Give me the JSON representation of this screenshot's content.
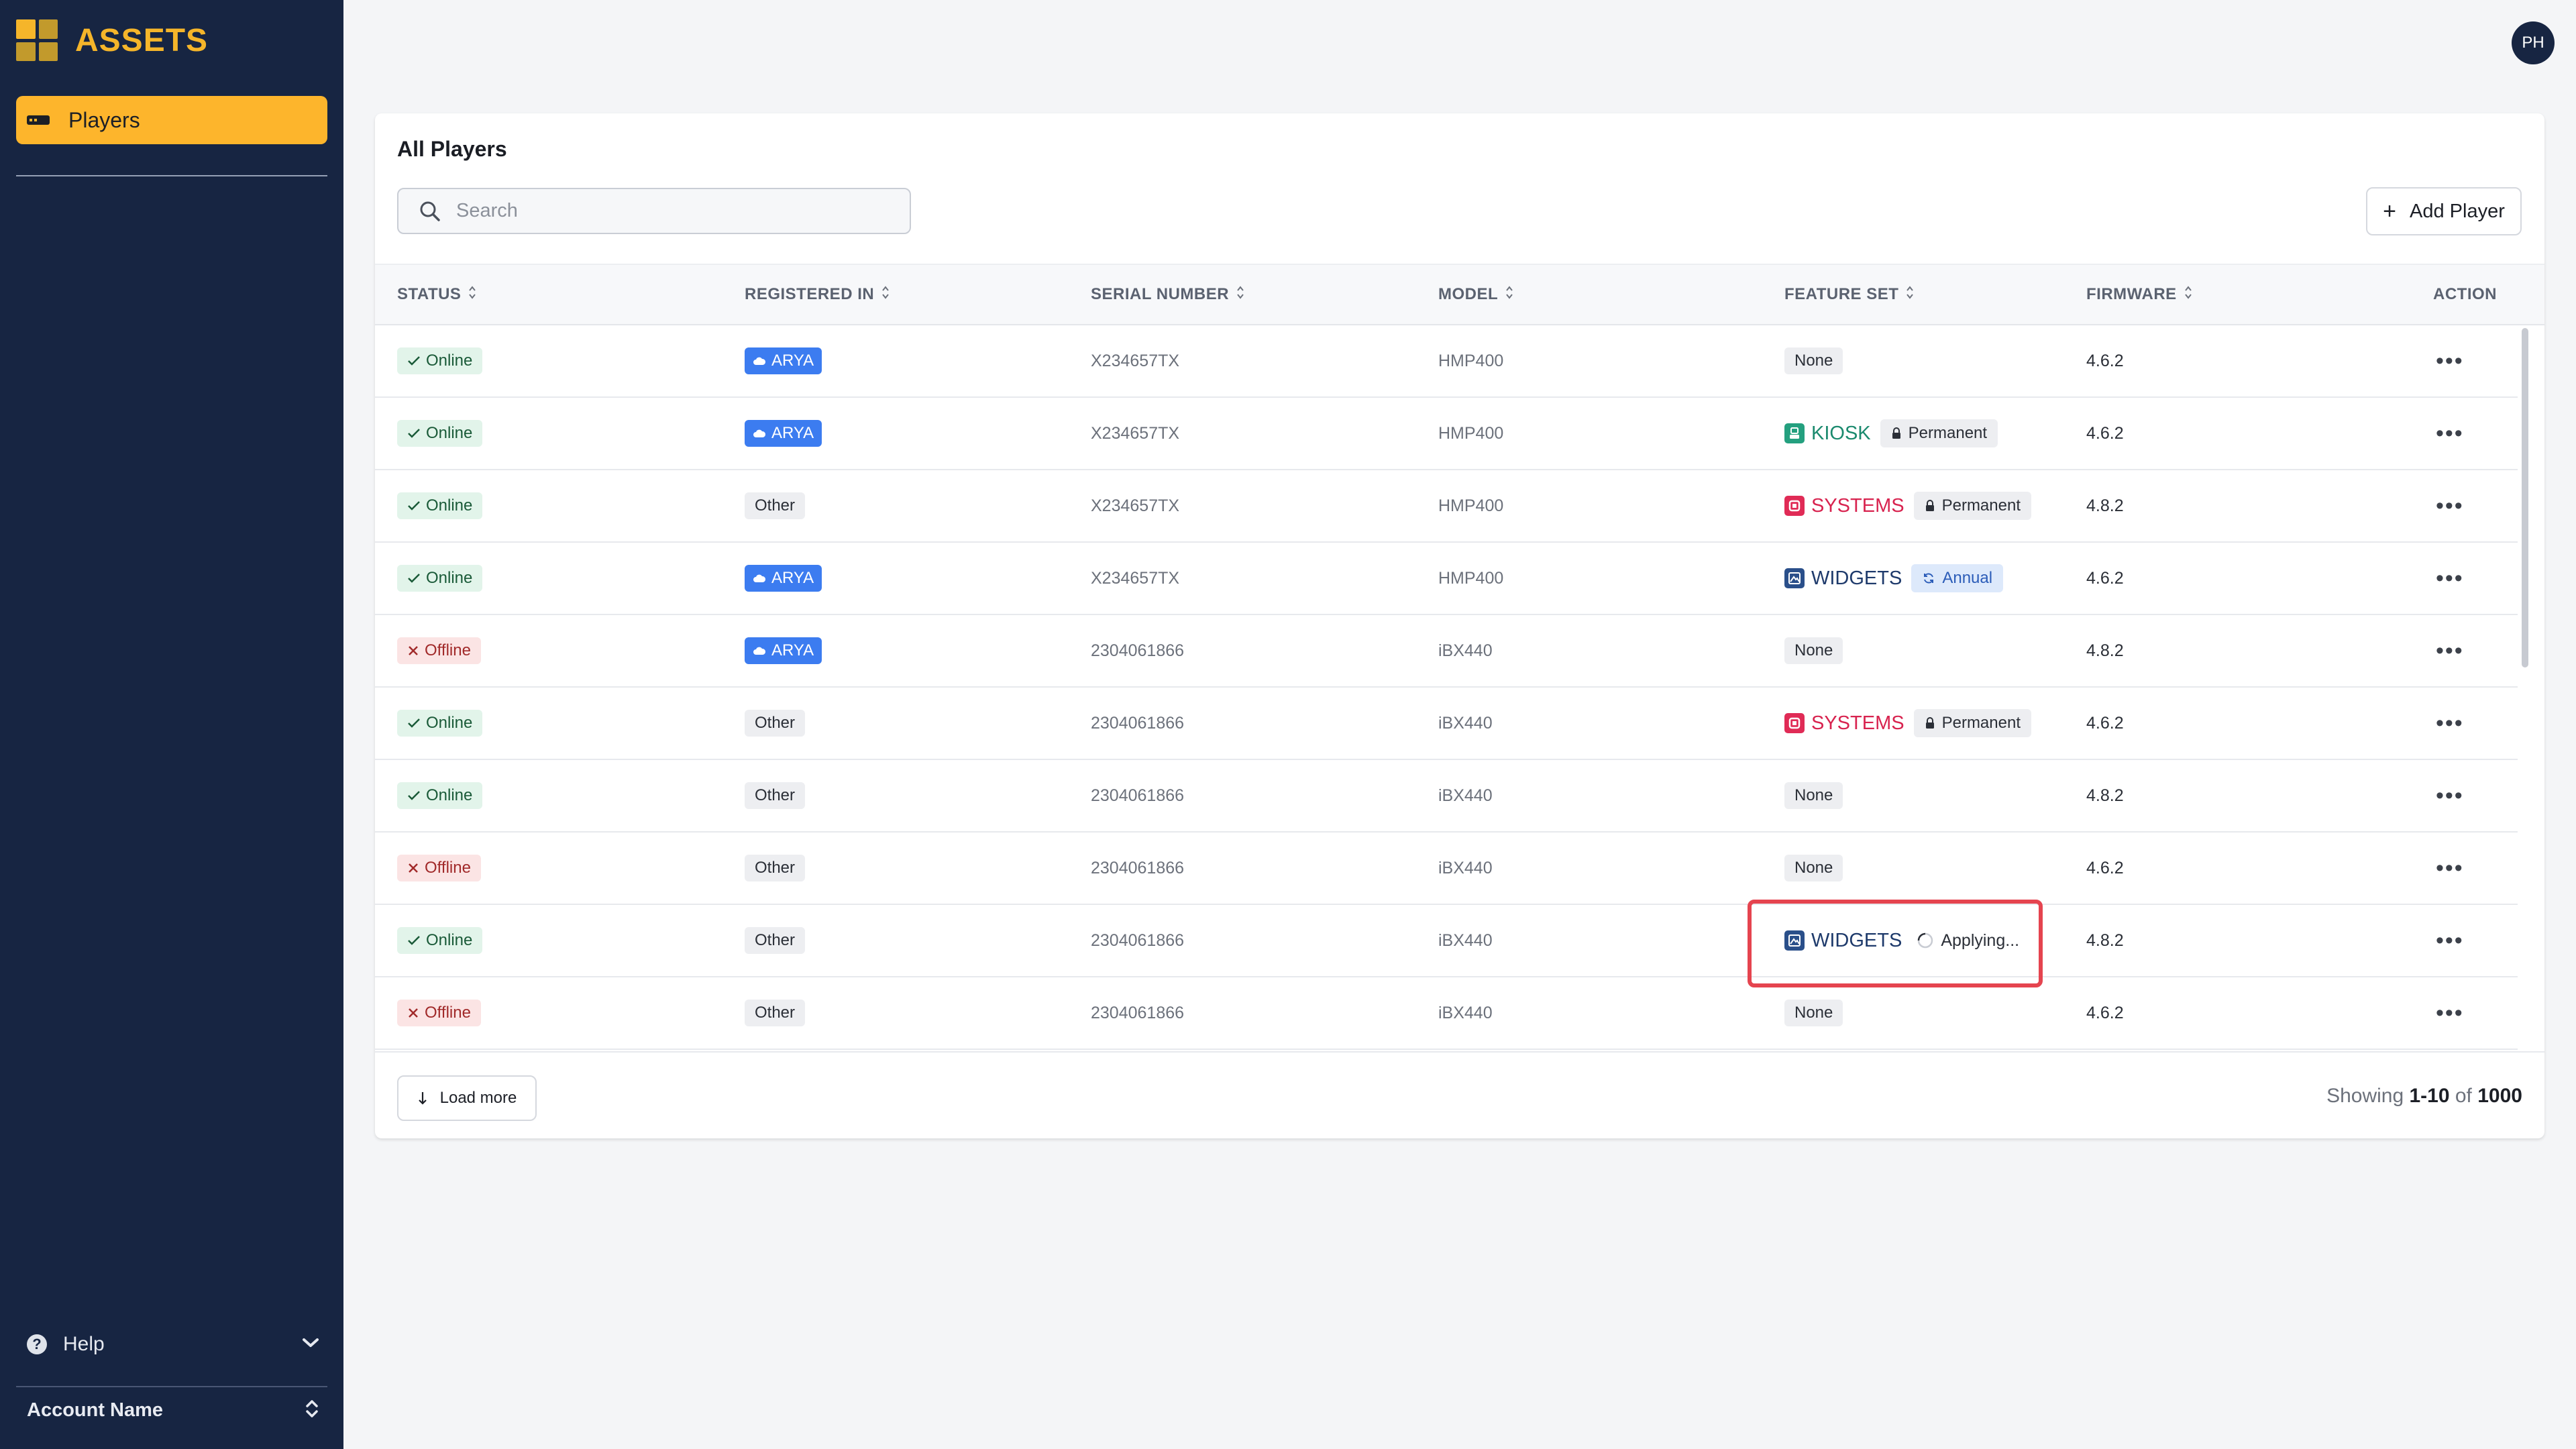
{
  "app": {
    "brand": "ASSETS"
  },
  "sidebar": {
    "nav": [
      {
        "label": "Players",
        "icon": "player-icon",
        "active": true
      }
    ],
    "help_label": "Help",
    "account_label": "Account Name"
  },
  "user": {
    "initials": "PH"
  },
  "main": {
    "title": "All Players",
    "search_placeholder": "Search",
    "add_button_label": "Add Player",
    "columns": [
      "STATUS",
      "REGISTERED IN",
      "SERIAL NUMBER",
      "MODEL",
      "FEATURE SET",
      "FIRMWARE",
      "ACTION"
    ],
    "rows": [
      {
        "status": "Online",
        "registered": "ARYA",
        "serial": "X234657TX",
        "model": "HMP400",
        "feature": "None",
        "license": "",
        "firmware": "4.6.2",
        "action": "•••"
      },
      {
        "status": "Online",
        "registered": "ARYA",
        "serial": "X234657TX",
        "model": "HMP400",
        "feature": "KIOSK",
        "license": "Permanent",
        "firmware": "4.6.2",
        "action": "•••"
      },
      {
        "status": "Online",
        "registered": "Other",
        "serial": "X234657TX",
        "model": "HMP400",
        "feature": "SYSTEMS",
        "license": "Permanent",
        "firmware": "4.8.2",
        "action": "•••"
      },
      {
        "status": "Online",
        "registered": "ARYA",
        "serial": "X234657TX",
        "model": "HMP400",
        "feature": "WIDGETS",
        "license": "Annual",
        "firmware": "4.6.2",
        "action": "•••"
      },
      {
        "status": "Offline",
        "registered": "ARYA",
        "serial": "2304061866",
        "model": "iBX440",
        "feature": "None",
        "license": "",
        "firmware": "4.8.2",
        "action": "•••"
      },
      {
        "status": "Online",
        "registered": "Other",
        "serial": "2304061866",
        "model": "iBX440",
        "feature": "SYSTEMS",
        "license": "Permanent",
        "firmware": "4.6.2",
        "action": "•••"
      },
      {
        "status": "Online",
        "registered": "Other",
        "serial": "2304061866",
        "model": "iBX440",
        "feature": "None",
        "license": "",
        "firmware": "4.8.2",
        "action": "•••"
      },
      {
        "status": "Offline",
        "registered": "Other",
        "serial": "2304061866",
        "model": "iBX440",
        "feature": "None",
        "license": "",
        "firmware": "4.6.2",
        "action": "•••"
      },
      {
        "status": "Online",
        "registered": "Other",
        "serial": "2304061866",
        "model": "iBX440",
        "feature": "WIDGETS",
        "license": "Applying...",
        "firmware": "4.8.2",
        "action": "•••"
      },
      {
        "status": "Offline",
        "registered": "Other",
        "serial": "2304061866",
        "model": "iBX440",
        "feature": "None",
        "license": "",
        "firmware": "4.6.2",
        "action": "•••"
      }
    ],
    "load_more_label": "Load more",
    "showing": {
      "prefix": "Showing",
      "range": "1-10",
      "of": "of",
      "total": "1000"
    }
  },
  "colors": {
    "sidebar_bg": "#172542",
    "brand_accent": "#f5b52a",
    "active_nav": "#fdb52c",
    "online": "#1a5a38",
    "offline": "#a12a2a",
    "arya_badge": "#3c7cf0",
    "kiosk": "#1b8a6e",
    "systems": "#d8234f",
    "widgets": "#1e3a6b",
    "highlight": "#e5444f"
  },
  "icons": {
    "search": "search-icon",
    "add": "plus-icon",
    "help": "help-circle-icon",
    "check": "check-icon",
    "cross": "x-icon",
    "cloud": "cloud-icon",
    "lock": "lock-icon",
    "refresh": "refresh-icon",
    "spinner": "spinner-icon",
    "sort": "sort-icon",
    "load_more": "arrow-down-icon",
    "chevron_down": "chevron-down-icon",
    "chevron_updown": "chevron-updown-icon"
  }
}
